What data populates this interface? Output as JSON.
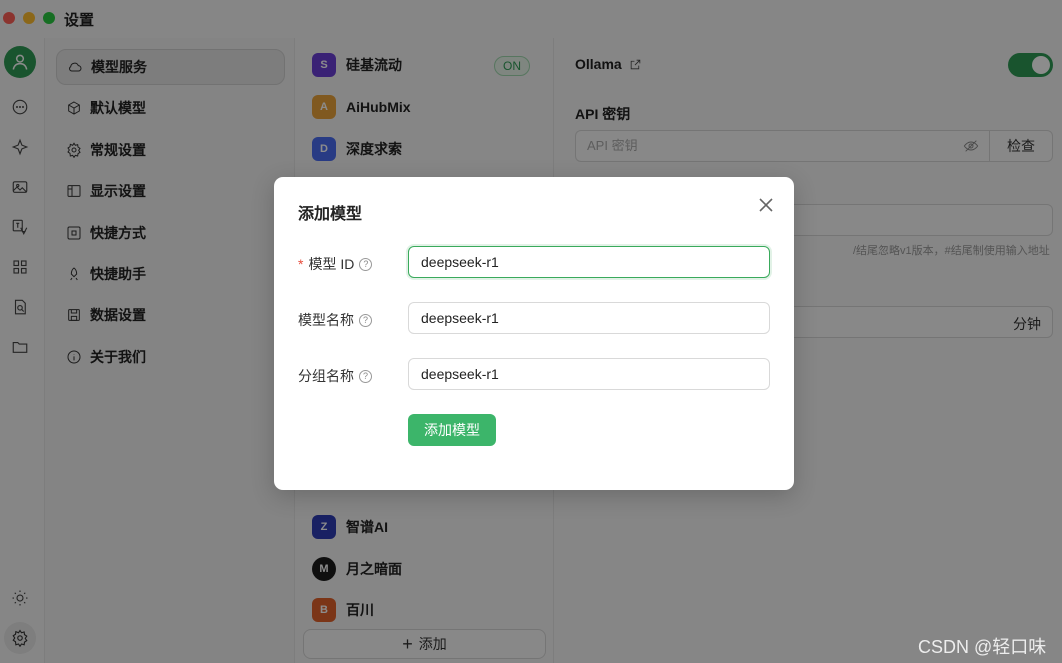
{
  "window": {
    "title": "设置"
  },
  "nav": {
    "items": [
      {
        "label": "模型服务",
        "icon": "cloud-icon",
        "active": true
      },
      {
        "label": "默认模型",
        "icon": "cube-icon"
      },
      {
        "label": "常规设置",
        "icon": "gear-icon"
      },
      {
        "label": "显示设置",
        "icon": "layout-icon"
      },
      {
        "label": "快捷方式",
        "icon": "command-icon"
      },
      {
        "label": "快捷助手",
        "icon": "rocket-icon"
      },
      {
        "label": "数据设置",
        "icon": "save-icon"
      },
      {
        "label": "关于我们",
        "icon": "info-icon"
      }
    ]
  },
  "providers": {
    "items": [
      {
        "name": "硅基流动",
        "badge": "ON",
        "color": "#6b3fd6"
      },
      {
        "name": "AiHubMix",
        "color": "#e9a23b"
      },
      {
        "name": "深度求索",
        "color": "#4a6cf0"
      },
      {
        "name": "智谱AI",
        "color": "#2f3cb5"
      },
      {
        "name": "月之暗面",
        "color": "#1d1d1d"
      },
      {
        "name": "百川",
        "color": "#e0622b"
      }
    ],
    "add_label": "添加"
  },
  "panel": {
    "provider_name": "Ollama",
    "api_key_label": "API 密钥",
    "api_key_placeholder": "API 密钥",
    "check_label": "检查",
    "hint": "/结尾忽略v1版本，#结尾制使用输入地址",
    "minutes_unit": "分钟"
  },
  "modal": {
    "title": "添加模型",
    "fields": [
      {
        "label": "模型 ID",
        "required": true,
        "value": "deepseek-r1"
      },
      {
        "label": "模型名称",
        "required": false,
        "value": "deepseek-r1"
      },
      {
        "label": "分组名称",
        "required": false,
        "value": "deepseek-r1"
      }
    ],
    "submit_label": "添加模型"
  },
  "watermark": "CSDN @轻口味",
  "colors": {
    "accent": "#3cb56a",
    "toggle_on": "#2f9a55"
  }
}
